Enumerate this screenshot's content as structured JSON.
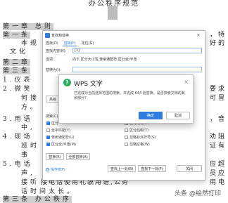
{
  "document": {
    "title": "办公秩序规范",
    "lines": [
      {
        "text": "第一章  总则"
      },
      {
        "text": "第一条"
      },
      {
        "text": "本规"
      },
      {
        "text": "文化"
      },
      {
        "text": "第二章"
      },
      {
        "text": "第三条"
      },
      {
        "text": "1.仪表"
      },
      {
        "text": "2.微笑"
      },
      {
        "text": "何接"
      },
      {
        "text": "方。"
      },
      {
        "text": "3.用语"
      },
      {
        "text": "中,"
      },
      {
        "text": "4.现场"
      },
      {
        "text": "班时"
      },
      {
        "text": "事"
      },
      {
        "text": "5.电话"
      },
      {
        "text": "声,"
      },
      {
        "text": "接听"
      },
      {
        "text": "话时间太长。"
      },
      {
        "text": "第三条  办公秩序"
      }
    ],
    "right_fragments": [
      "，特",
      "好的",
      "要求",
      "可冒",
      "，音",
      "劝阻",
      "证有",
      "应超",
      "员应",
      "用电"
    ],
    "middle_fragment": "接电话使用礼貌用语,公务"
  },
  "find_dialog": {
    "title": "查找和替换",
    "close": "×",
    "tabs": [
      "查找(D)",
      "替换(P)",
      "定位(G)"
    ],
    "find_label": "查找内容(N):",
    "find_value": "[1]",
    "options_label": "选项:",
    "options_value": "向下,区分大小写,使用通配符,区分全/半角",
    "replace_label": "替换为(I):",
    "more_button": "高级",
    "search_label": "搜索(C)",
    "checkboxes": [
      {
        "label": "区分"
      },
      {
        "label": "全字匹配(Y)"
      },
      {
        "label": "使用通配符(U)"
      },
      {
        "label": "区分全/半角(M)"
      },
      {
        "label": "区分前缀(X)"
      },
      {
        "label": "区分后缀(T)"
      },
      {
        "label": "忽略标点符号(S)"
      },
      {
        "label": "忽略空格(W)"
      }
    ],
    "replace_button": "替换(R)",
    "replace_all_button": "全部替换(A)",
    "tips_link": "操作技巧",
    "find_prev_button": "查找上一处(B)",
    "find_next_button": "查找下一处(F)",
    "close_button": "关闭"
  },
  "message_box": {
    "title": "WPS 文字",
    "close": "×",
    "message": "已完成对当前选择范围的搜索。并完成 644 处替换。是否搜索文档的其余部分？",
    "ok": "确定",
    "cancel": "取消"
  },
  "watermark": "头条 @绘然打印",
  "colors": {
    "accent": "#2f7de1",
    "question_icon": "#27ae60"
  }
}
